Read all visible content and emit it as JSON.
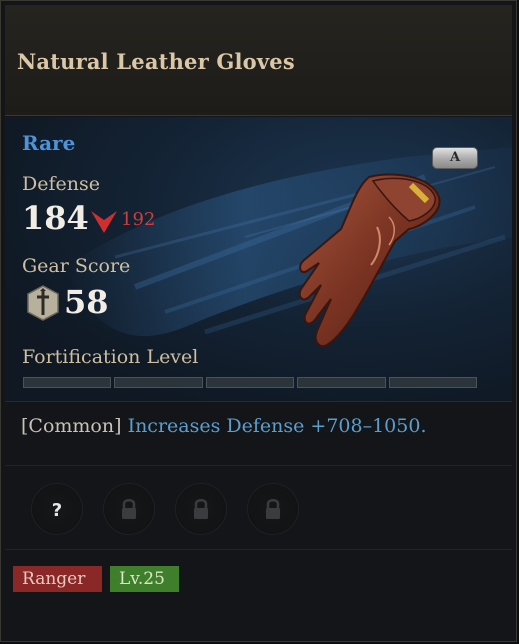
{
  "item": {
    "name": "Natural Leather Gloves",
    "rarity": "Rare",
    "grade": "A",
    "icon": "leather-glove-icon",
    "rarity_color": "#4e93d9"
  },
  "stats": {
    "defense_label": "Defense",
    "defense_value": "184",
    "defense_compare": "192",
    "compare_icon": "down-arrow-icon",
    "gear_score_label": "Gear Score",
    "gear_score_icon": "gear-score-dagger-icon",
    "gear_score_value": "58"
  },
  "fortification": {
    "label": "Fortification Level",
    "segments_filled": 0,
    "segments_total": 5
  },
  "effect": {
    "tier": "[Common]",
    "text": "Increases Defense +708–1050."
  },
  "sockets": [
    {
      "icon": "question-mark-icon",
      "state": "unknown"
    },
    {
      "icon": "lock-icon",
      "state": "locked"
    },
    {
      "icon": "lock-icon",
      "state": "locked"
    },
    {
      "icon": "lock-icon",
      "state": "locked"
    }
  ],
  "requirements": {
    "class": "Ranger",
    "level": "Lv.25"
  },
  "colors": {
    "title": "#d9c7a6",
    "compare_down": "#cf3d3d",
    "class_tag": "#8a2828",
    "level_tag": "#3f7e2a"
  }
}
